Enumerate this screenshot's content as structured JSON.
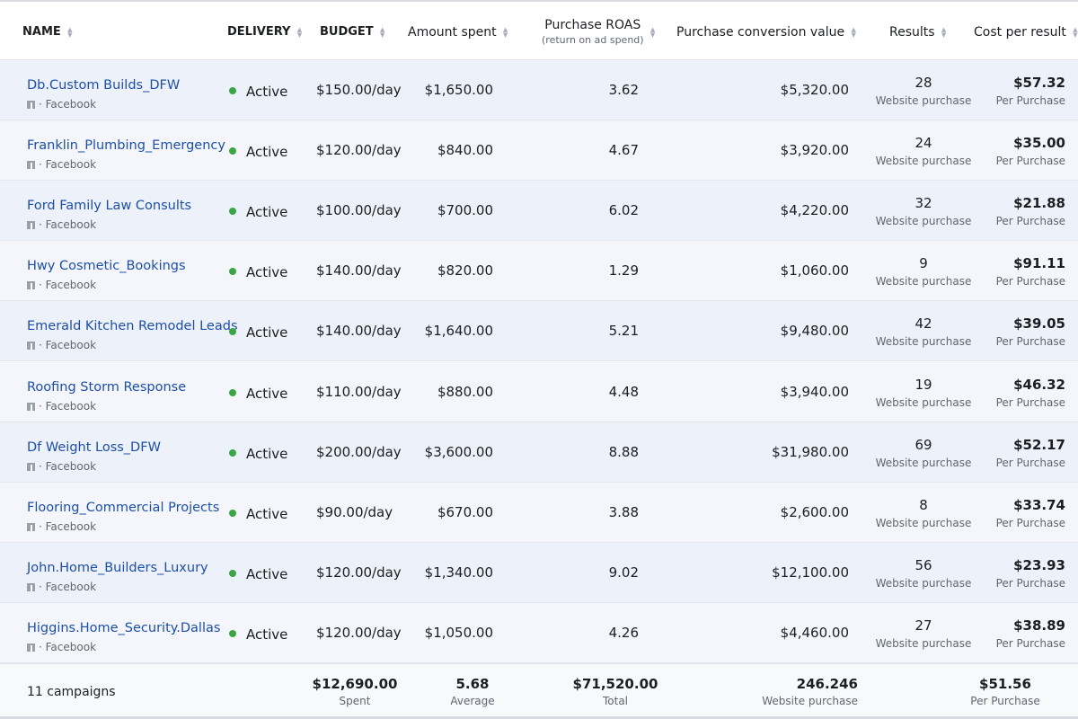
{
  "header": {
    "name": "NAME",
    "delivery": "DELIVERY",
    "budget": "BUDGET",
    "amount_spent": "Amount spent",
    "roas": "Purchase ROAS",
    "roas_sub": "(return on ad spend)",
    "conv_value": "Purchase conversion value",
    "results": "Results",
    "cost_per_result": "Cost per result"
  },
  "rows": [
    {
      "name": "Db.Custom Builds_DFW",
      "platform": "· Facebook",
      "delivery": "Active",
      "budget": "$150.00/day",
      "spent": "$1,650.00",
      "roas": "3.62",
      "conv": "$5,320.00",
      "results": "28",
      "results_sub": "Website purchase",
      "cpr": "$57.32",
      "cpr_sub": "Per Purchase"
    },
    {
      "name": "Franklin_Plumbing_Emergency",
      "platform": "· Facebook",
      "delivery": "Active",
      "budget": "$120.00/day",
      "spent": "$840.00",
      "roas": "4.67",
      "conv": "$3,920.00",
      "results": "24",
      "results_sub": "Website purchase",
      "cpr": "$35.00",
      "cpr_sub": "Per Purchase"
    },
    {
      "name": "Ford Family Law Consults",
      "platform": "· Facebook",
      "delivery": "Active",
      "budget": "$100.00/day",
      "spent": "$700.00",
      "roas": "6.02",
      "conv": "$4,220.00",
      "results": "32",
      "results_sub": "Website purchase",
      "cpr": "$21.88",
      "cpr_sub": "Per Purchase"
    },
    {
      "name": "Hwy Cosmetic_Bookings",
      "platform": "· Facebook",
      "delivery": "Active",
      "budget": "$140.00/day",
      "spent": "$820.00",
      "roas": "1.29",
      "conv": "$1,060.00",
      "results": "9",
      "results_sub": "Website purchase",
      "cpr": "$91.11",
      "cpr_sub": "Per Purchase"
    },
    {
      "name": "Emerald Kitchen Remodel Leads",
      "platform": "· Facebook",
      "delivery": "Active",
      "budget": "$140.00/day",
      "spent": "$1,640.00",
      "roas": "5.21",
      "conv": "$9,480.00",
      "results": "42",
      "results_sub": "Website purchase",
      "cpr": "$39.05",
      "cpr_sub": "Per Purchase"
    },
    {
      "name": "Roofing Storm Response",
      "platform": "· Facebook",
      "delivery": "Active",
      "budget": "$110.00/day",
      "spent": "$880.00",
      "roas": "4.48",
      "conv": "$3,940.00",
      "results": "19",
      "results_sub": "Website purchase",
      "cpr": "$46.32",
      "cpr_sub": "Per Purchase"
    },
    {
      "name": "Df Weight Loss_DFW",
      "platform": "· Facebook",
      "delivery": "Active",
      "budget": "$200.00/day",
      "spent": "$3,600.00",
      "roas": "8.88",
      "conv": "$31,980.00",
      "results": "69",
      "results_sub": "Website purchase",
      "cpr": "$52.17",
      "cpr_sub": "Per Purchase"
    },
    {
      "name": "Flooring_Commercial Projects",
      "platform": "· Facebook",
      "delivery": "Active",
      "budget": "$90.00/day",
      "spent": "$670.00",
      "roas": "3.88",
      "conv": "$2,600.00",
      "results": "8",
      "results_sub": "Website purchase",
      "cpr": "$33.74",
      "cpr_sub": "Per Purchase"
    },
    {
      "name": "John.Home_Builders_Luxury",
      "platform": "· Facebook",
      "delivery": "Active",
      "budget": "$120.00/day",
      "spent": "$1,340.00",
      "roas": "9.02",
      "conv": "$12,100.00",
      "results": "56",
      "results_sub": "Website purchase",
      "cpr": "$23.93",
      "cpr_sub": "Per Purchase"
    },
    {
      "name": "Higgins.Home_Security.Dallas",
      "platform": "· Facebook",
      "delivery": "Active",
      "budget": "$120.00/day",
      "spent": "$1,050.00",
      "roas": "4.26",
      "conv": "$4,460.00",
      "results": "27",
      "results_sub": "Website purchase",
      "cpr": "$38.89",
      "cpr_sub": "Per Purchase"
    }
  ],
  "footer": {
    "count": "11 campaigns",
    "spent": "$12,690.00",
    "spent_sub": "Spent",
    "roas": "5.68",
    "roas_sub": "Average",
    "conv": "$71,520.00",
    "conv_sub": "Total",
    "results": "246.246",
    "results_sub": "Website purchase",
    "cpr": "$51.56",
    "cpr_sub": "Per Purchase"
  },
  "colors": {
    "link": "#1d4fa8",
    "active": "#3aa544"
  }
}
